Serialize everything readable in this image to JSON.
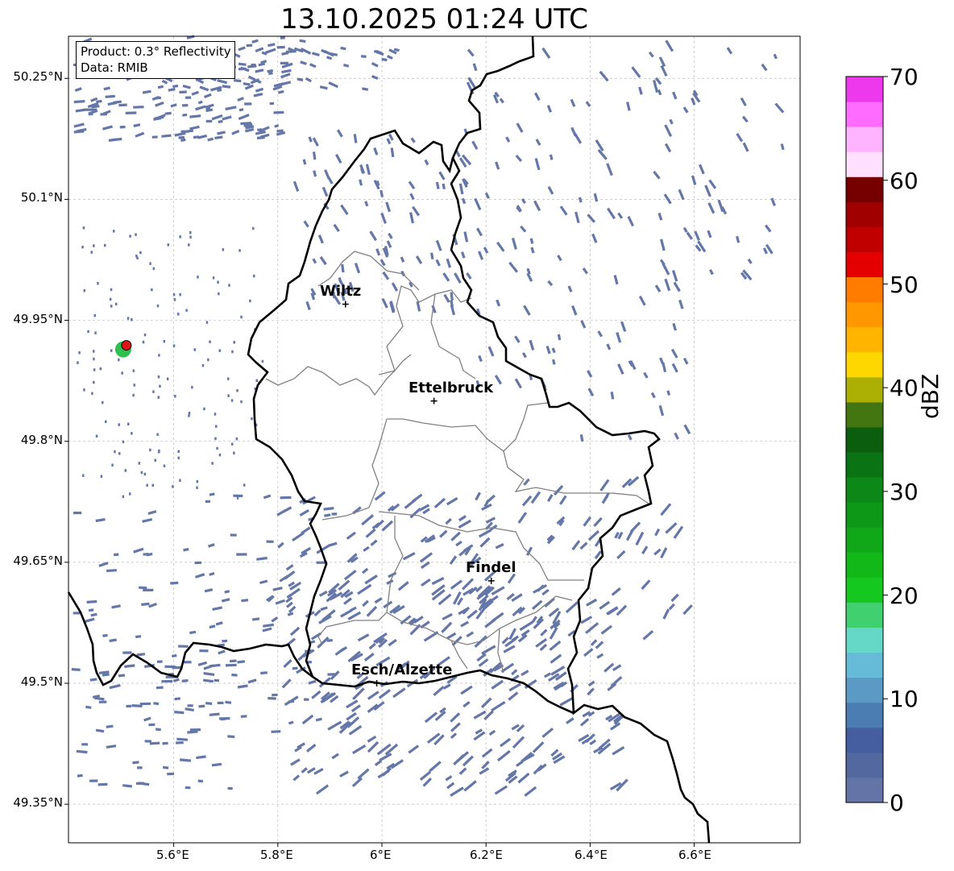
{
  "title": "13.10.2025 01:24 UTC",
  "info": {
    "product": "Product: 0.3° Reflectivity",
    "data": "Data: RMIB"
  },
  "lat_labels": [
    "50.25°N",
    "50.1°N",
    "49.95°N",
    "49.8°N",
    "49.65°N",
    "49.5°N",
    "49.35°N"
  ],
  "lon_labels": [
    "5.6°E",
    "5.8°E",
    "6°E",
    "6.2°E",
    "6.4°E",
    "6.6°E"
  ],
  "cities": [
    {
      "name": "Wiltz",
      "lon": 5.93,
      "lat": 49.97
    },
    {
      "name": "Ettelbruck",
      "lon": 6.1,
      "lat": 49.85
    },
    {
      "name": "Findel",
      "lon": 6.21,
      "lat": 49.627
    },
    {
      "name": "Esch/Alzette",
      "lon": 5.99,
      "lat": 49.5
    }
  ],
  "radar_site": {
    "lon": 5.506,
    "lat": 49.917,
    "color": "#e01414"
  },
  "colorbar": {
    "label": "dBZ",
    "min": 0,
    "max": 70,
    "ticks": [
      "0",
      "10",
      "20",
      "30",
      "40",
      "50",
      "60",
      "70"
    ],
    "colors": [
      "#6474a6",
      "#5468a0",
      "#445ea0",
      "#4b7cb2",
      "#5a9ac4",
      "#66bcd8",
      "#66d8c8",
      "#40d070",
      "#14c820",
      "#12b818",
      "#10a818",
      "#0e9818",
      "#0c8818",
      "#0a7414",
      "#0a5e0e",
      "#437610",
      "#adb004",
      "#ffd700",
      "#ffb400",
      "#ff9800",
      "#ff7c00",
      "#e40000",
      "#c00000",
      "#a00000",
      "#760000",
      "#ffe0ff",
      "#ffb4ff",
      "#ff6cff",
      "#ee38ee"
    ]
  },
  "colors": {
    "echo": "#6477a8",
    "border": "#000000",
    "canton": "#808080",
    "grid": "#bbbbbb"
  }
}
